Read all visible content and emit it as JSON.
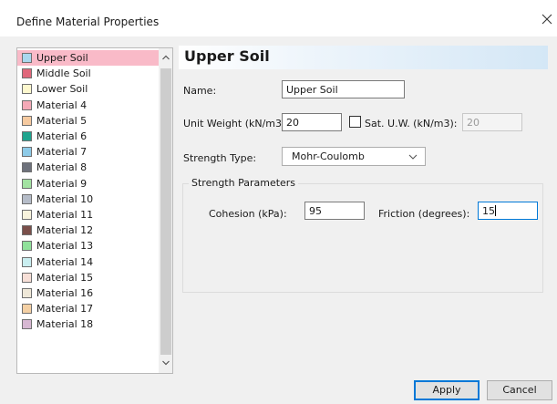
{
  "window": {
    "title": "Define Material Properties"
  },
  "materials": [
    {
      "name": "Upper Soil",
      "color": "#a9d7ee",
      "selected": true
    },
    {
      "name": "Middle Soil",
      "color": "#e0687b"
    },
    {
      "name": "Lower Soil",
      "color": "#fdf8ce"
    },
    {
      "name": "Material 4",
      "color": "#f4a9b7"
    },
    {
      "name": "Material 5",
      "color": "#f6caa0"
    },
    {
      "name": "Material 6",
      "color": "#1fa48e"
    },
    {
      "name": "Material 7",
      "color": "#8ecbe8"
    },
    {
      "name": "Material 8",
      "color": "#6d717b"
    },
    {
      "name": "Material 9",
      "color": "#a3e3a2"
    },
    {
      "name": "Material 10",
      "color": "#b5bcc8"
    },
    {
      "name": "Material 11",
      "color": "#f8f3dc"
    },
    {
      "name": "Material 12",
      "color": "#7a4f4a"
    },
    {
      "name": "Material 13",
      "color": "#8fe19a"
    },
    {
      "name": "Material 14",
      "color": "#c9eef0"
    },
    {
      "name": "Material 15",
      "color": "#f7dfd7"
    },
    {
      "name": "Material 16",
      "color": "#efe8d8"
    },
    {
      "name": "Material 17",
      "color": "#f4d0a4"
    },
    {
      "name": "Material 18",
      "color": "#d7b7d2"
    }
  ],
  "properties": {
    "header": "Upper Soil",
    "name_label": "Name:",
    "name_value": "Upper Soil",
    "unit_weight_label": "Unit Weight (kN/m3):",
    "unit_weight_value": "20",
    "sat_uw_label": "Sat. U.W. (kN/m3):",
    "sat_uw_value": "20",
    "sat_uw_checked": false,
    "strength_type_label": "Strength Type:",
    "strength_type_value": "Mohr-Coulomb"
  },
  "strength_parameters": {
    "title": "Strength Parameters",
    "cohesion_label": "Cohesion (kPa):",
    "cohesion_value": "95",
    "friction_label": "Friction (degrees):",
    "friction_value": "15"
  },
  "buttons": {
    "apply": "Apply",
    "cancel": "Cancel"
  },
  "icons": {
    "close": "close-icon",
    "scroll_up": "chevron-up-icon",
    "scroll_down": "chevron-down-icon",
    "dropdown": "chevron-down-icon"
  },
  "colors": {
    "selection": "#f9bac8",
    "accent": "#0078d7",
    "header_gradient_end": "#d4e7f6"
  }
}
